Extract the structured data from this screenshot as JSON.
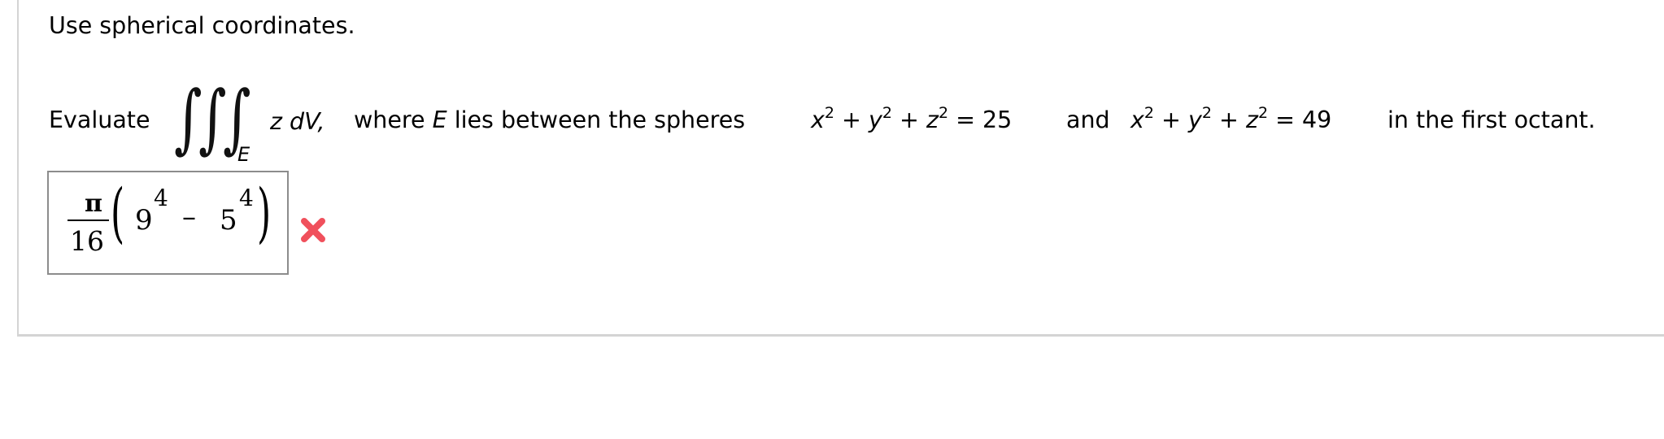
{
  "question": {
    "instruction": "Use spherical coordinates.",
    "prompt": {
      "evaluate_label": "Evaluate",
      "integral_symbol": "∭",
      "integral_signs": [
        "∫",
        "∫",
        "∫"
      ],
      "region_subscript": "E",
      "integrand": "z dV,",
      "where_text": "where",
      "region_var": "E",
      "lies_text": "lies between the spheres",
      "sphere1": {
        "x": "x",
        "y": "y",
        "z": "z",
        "exponent": "2",
        "plus": "+",
        "equals": "=",
        "value": "25"
      },
      "and_text": "and",
      "sphere2": {
        "x": "x",
        "y": "y",
        "z": "z",
        "exponent": "2",
        "plus": "+",
        "equals": "=",
        "value": "49"
      },
      "tail_text": "in the first octant."
    }
  },
  "answer": {
    "numerator": "π",
    "denominator": "16",
    "open_paren": "(",
    "base1": "9",
    "exp1": "4",
    "minus": "–",
    "base2": "5",
    "exp2": "4",
    "close_paren": ")",
    "full_text": "π/16 (9^4 − 5^4)",
    "status": "incorrect",
    "status_icon": "x-mark-icon",
    "status_color": "#f0505c"
  }
}
